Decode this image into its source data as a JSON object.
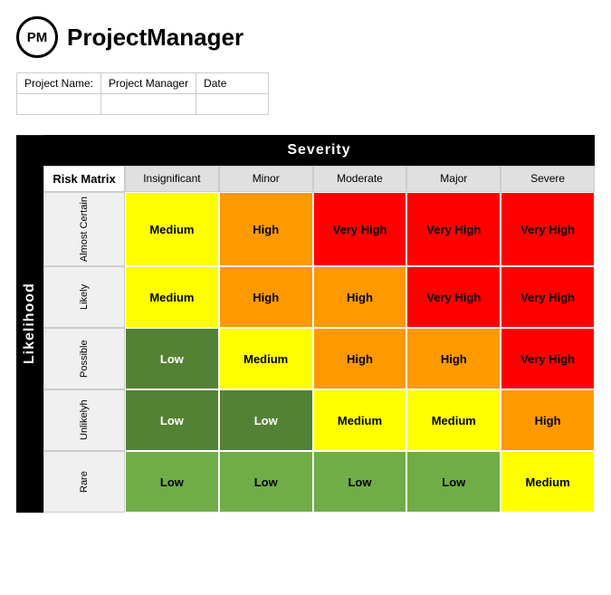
{
  "header": {
    "logo_text": "PM",
    "app_title": "ProjectManager"
  },
  "project_info": {
    "labels": [
      "Project Name:",
      "Project Manager",
      "Date"
    ],
    "values": [
      "",
      "",
      ""
    ]
  },
  "matrix": {
    "likelihood_label": "Likelihood",
    "severity_label": "Severity",
    "risk_matrix_label": "Risk Matrix",
    "col_headers": [
      "Insignificant",
      "Minor",
      "Moderate",
      "Major",
      "Severe"
    ],
    "rows": [
      {
        "label": "Almost Certain",
        "cells": [
          {
            "text": "Medium",
            "color": "color-yellow"
          },
          {
            "text": "High",
            "color": "color-orange"
          },
          {
            "text": "Very High",
            "color": "color-red"
          },
          {
            "text": "Very High",
            "color": "color-red"
          },
          {
            "text": "Very High",
            "color": "color-red"
          }
        ]
      },
      {
        "label": "Likely",
        "cells": [
          {
            "text": "Medium",
            "color": "color-yellow"
          },
          {
            "text": "High",
            "color": "color-orange"
          },
          {
            "text": "High",
            "color": "color-orange"
          },
          {
            "text": "Very High",
            "color": "color-red"
          },
          {
            "text": "Very High",
            "color": "color-red"
          }
        ]
      },
      {
        "label": "Possible",
        "cells": [
          {
            "text": "Low",
            "color": "color-green-dark"
          },
          {
            "text": "Medium",
            "color": "color-yellow"
          },
          {
            "text": "High",
            "color": "color-orange"
          },
          {
            "text": "High",
            "color": "color-orange"
          },
          {
            "text": "Very High",
            "color": "color-red"
          }
        ]
      },
      {
        "label": "Unlikelyh",
        "cells": [
          {
            "text": "Low",
            "color": "color-green-dark"
          },
          {
            "text": "Low",
            "color": "color-green-dark"
          },
          {
            "text": "Medium",
            "color": "color-yellow"
          },
          {
            "text": "Medium",
            "color": "color-yellow"
          },
          {
            "text": "High",
            "color": "color-orange"
          }
        ]
      },
      {
        "label": "Rare",
        "cells": [
          {
            "text": "Low",
            "color": "color-green"
          },
          {
            "text": "Low",
            "color": "color-green"
          },
          {
            "text": "Low",
            "color": "color-green"
          },
          {
            "text": "Low",
            "color": "color-green"
          },
          {
            "text": "Medium",
            "color": "color-yellow"
          }
        ]
      }
    ]
  }
}
